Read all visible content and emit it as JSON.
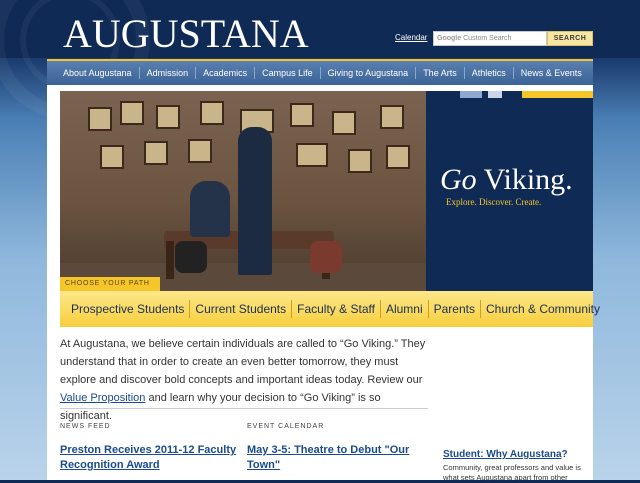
{
  "header": {
    "logo": "AUGUSTANA",
    "calendar_link": "Calendar",
    "search": {
      "google_label": "Google",
      "placeholder": "Custom Search",
      "button": "SEARCH"
    }
  },
  "nav": {
    "items": [
      "About Augustana",
      "Admission",
      "Academics",
      "Campus Life",
      "Giving to Augustana",
      "The Arts",
      "Athletics",
      "News & Events"
    ]
  },
  "hero": {
    "choose_path": "CHOOSE YOUR PATH",
    "goviking_italic": "Go",
    "goviking_rest": " Viking.",
    "tagline": "Explore. Discover. Create."
  },
  "audience": {
    "items": [
      "Prospective Students",
      "Current Students",
      "Faculty & Staff",
      "Alumni",
      "Parents",
      "Church & Community"
    ]
  },
  "intro": {
    "part1": "At Augustana, we believe certain individuals are called to “Go Viking.” They understand that in order to create an even better tomorrow, they must explore and discover bold concepts and important ideas today. Review our ",
    "link": "Value Proposition",
    "part2": " and learn why your decision to “Go Viking” is so significant."
  },
  "news_feed": {
    "label": "NEWS FEED",
    "headline": "Preston Receives 2011-12 Faculty Recognition Award"
  },
  "event_calendar": {
    "label": "EVENT CALENDAR",
    "headline": "May 3-5: Theatre to Debut \"Our Town\""
  },
  "sidebar": {
    "link": "Student: Why Augustana",
    "link_suffix": "?",
    "text": "Community, great professors and value is what sets Augustana apart from other"
  },
  "colors": {
    "navy": "#0f2a55",
    "gold": "#f5c52a",
    "link": "#1a4b8c"
  }
}
